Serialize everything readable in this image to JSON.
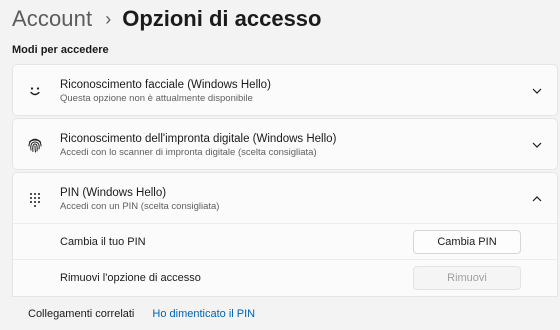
{
  "breadcrumb": {
    "parent": "Account",
    "separator": "›",
    "current": "Opzioni di accesso"
  },
  "section_title": "Modi per accedere",
  "options": [
    {
      "icon": "face-smile-icon",
      "title": "Riconoscimento facciale (Windows Hello)",
      "subtitle": "Questa opzione non è attualmente disponibile",
      "expanded": false
    },
    {
      "icon": "fingerprint-icon",
      "title": "Riconoscimento dell'impronta digitale (Windows Hello)",
      "subtitle": "Accedi con lo scanner di impronta digitale (scelta consigliata)",
      "expanded": false
    },
    {
      "icon": "pin-keypad-icon",
      "title": "PIN (Windows Hello)",
      "subtitle": "Accedi con un PIN (scelta consigliata)",
      "expanded": true
    }
  ],
  "pin_settings": {
    "change_label": "Cambia il tuo PIN",
    "change_button": "Cambia PIN",
    "remove_label": "Rimuovi l'opzione di accesso",
    "remove_button": "Rimuovi",
    "remove_button_disabled": true
  },
  "related": {
    "label": "Collegamenti correlati",
    "link": "Ho dimenticato il PIN"
  },
  "colors": {
    "background": "#f3f3f3",
    "card": "#fbfbfb",
    "link": "#0063b1"
  }
}
